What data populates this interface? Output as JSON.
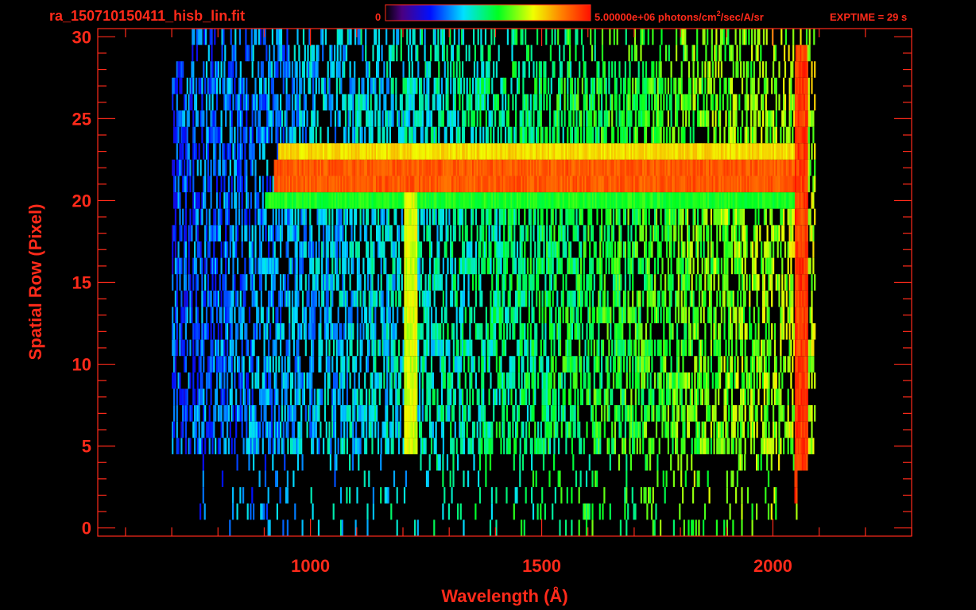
{
  "header": {
    "filename": "ra_150710150411_hisb_lin.fit",
    "colorbar_min_label": "0",
    "colorbar_max_label": "5.00000e+06 photons/cm",
    "colorbar_unit_sup": "2",
    "colorbar_unit_rest": "/sec/A/sr",
    "exptime": "EXPTIME = 29 s"
  },
  "colors": {
    "axis": "#ff2a1a",
    "background": "#000000"
  },
  "chart_data": {
    "type": "heatmap",
    "title": "ra_150710150411_hisb_lin.fit",
    "xlabel": "Wavelength (Å)",
    "ylabel": "Spatial Row (Pixel)",
    "xlim": [
      540,
      2300
    ],
    "ylim": [
      -0.5,
      30.5
    ],
    "x_ticks": [
      1000,
      1500,
      2000
    ],
    "x_tick_labels": [
      "1000",
      "1500",
      "2000"
    ],
    "y_ticks": [
      0,
      5,
      10,
      15,
      20,
      25,
      30
    ],
    "y_tick_labels": [
      "0",
      "5",
      "10",
      "15",
      "20",
      "25",
      "30"
    ],
    "colorbar": {
      "min": 0,
      "max": 5000000,
      "colormap": "rainbow"
    },
    "data_extent_x": [
      700,
      2090
    ],
    "rows": 31,
    "features": [
      {
        "name": "slit bright row",
        "rows": [
          21,
          22
        ],
        "x_range": [
          920,
          2050
        ],
        "level": 0.95
      },
      {
        "name": "slit upper edge",
        "rows": [
          23
        ],
        "x_range": [
          930,
          2050
        ],
        "level": 0.8
      },
      {
        "name": "slit lower edge",
        "rows": [
          20
        ],
        "x_range": [
          900,
          2050
        ],
        "level": 0.6
      },
      {
        "name": "Lyman-alpha line",
        "x": 1216,
        "rows_range": [
          5,
          23
        ],
        "level": 0.75
      },
      {
        "name": "edge stripe",
        "x": 2060,
        "rows_range": [
          2,
          29
        ],
        "level": 1.0
      }
    ]
  }
}
